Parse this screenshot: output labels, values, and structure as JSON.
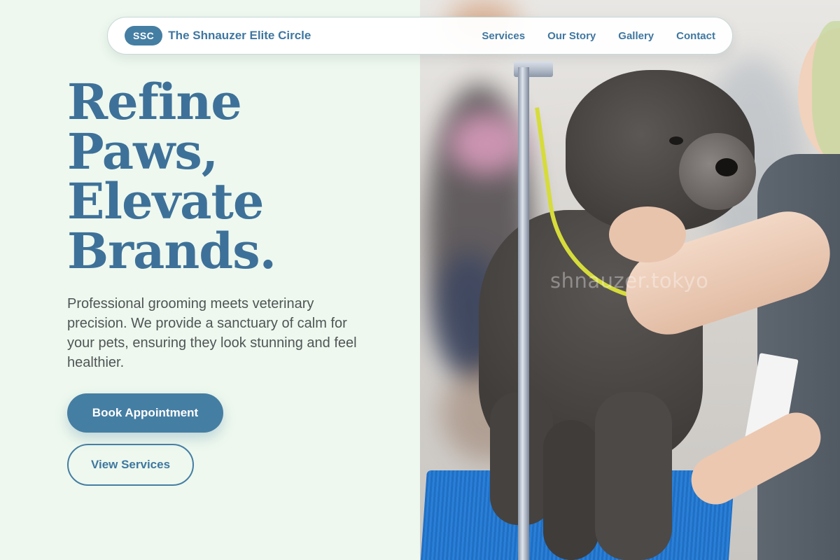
{
  "brand": {
    "badge": "SSC",
    "name": "The Shnauzer Elite Circle"
  },
  "nav": {
    "links": [
      "Services",
      "Our Story",
      "Gallery",
      "Contact"
    ]
  },
  "hero": {
    "title_lines": [
      "Refine",
      "Paws,",
      "Elevate",
      "Brands."
    ],
    "description": "Professional grooming meets veterinary precision. We provide a sanctuary of calm for your pets, ensuring they look stunning and feel healthier.",
    "primary_button": "Book Appointment",
    "secondary_button": "View Services"
  },
  "photo": {
    "watermark": "shnauzer.tokyo"
  },
  "colors": {
    "accent": "#457ea3",
    "title": "#3e7199",
    "background": "#eef8ee"
  }
}
